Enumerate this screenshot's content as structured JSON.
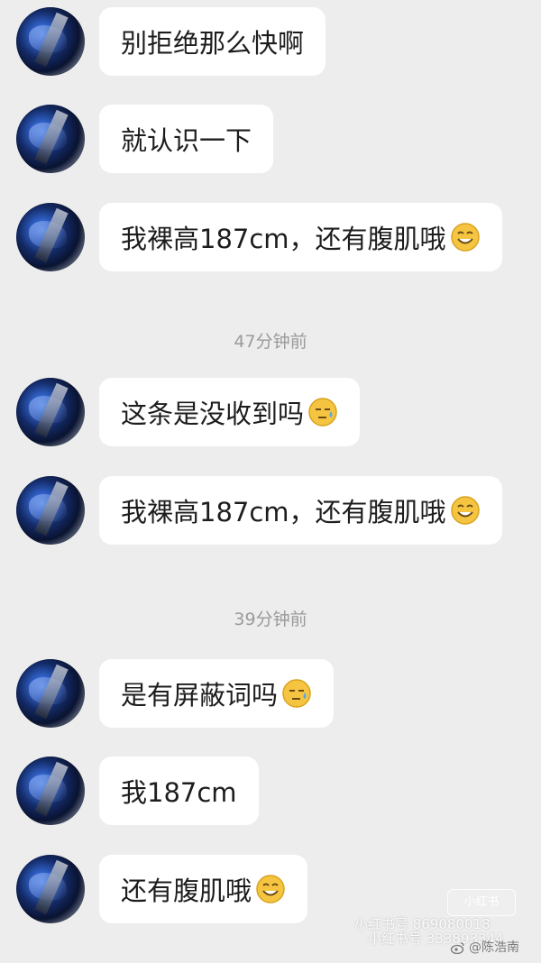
{
  "messages": [
    {
      "text": "别拒绝那么快啊",
      "emoji": ""
    },
    {
      "text": "就认识一下",
      "emoji": ""
    },
    {
      "text": "我裸高187cm，还有腹肌哦",
      "emoji": "smile-emoji"
    },
    {
      "text": "这条是没收到吗",
      "emoji": "sweat-emoji"
    },
    {
      "text": "我裸高187cm，还有腹肌哦",
      "emoji": "smile-emoji"
    },
    {
      "text": "是有屏蔽词吗",
      "emoji": "sweat-emoji"
    },
    {
      "text": "我187cm",
      "emoji": ""
    },
    {
      "text": "还有腹肌哦",
      "emoji": "smile-emoji"
    }
  ],
  "timestamps": [
    "47分钟前",
    "39分钟前"
  ],
  "watermark": {
    "badge": "小红书",
    "line1": "小红书号 869080018",
    "line2": "小红书号 333893344",
    "weibo": "@陈浩南"
  },
  "colors": {
    "background": "#ededed",
    "bubble": "#ffffff",
    "text": "#1d1d1d",
    "timestamp": "#9a9a9a",
    "emoji": "#f5c542"
  }
}
